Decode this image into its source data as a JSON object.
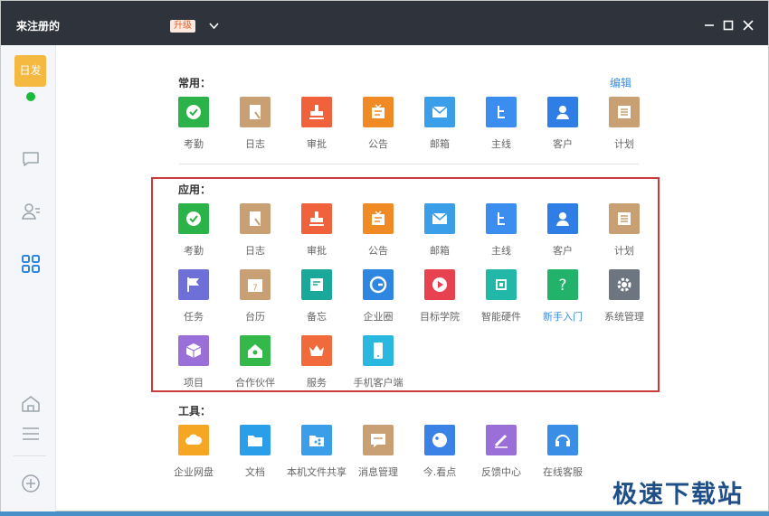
{
  "titlebar": {
    "title": "来注册的",
    "upgrade": "升级"
  },
  "sidebar": {
    "avatar_text": "日发",
    "items": [
      {
        "name": "chat",
        "icon": "chat-bubble-icon"
      },
      {
        "name": "contacts",
        "icon": "contacts-icon"
      },
      {
        "name": "apps",
        "icon": "apps-grid-icon"
      }
    ],
    "bottom": [
      {
        "name": "home",
        "icon": "home-icon"
      },
      {
        "name": "menu",
        "icon": "menu-icon"
      },
      {
        "name": "add",
        "icon": "add-circle-icon"
      }
    ]
  },
  "sections": {
    "common": {
      "label": "常用：",
      "edit": "编辑",
      "items": [
        {
          "label": "考勤",
          "icon": "check-icon",
          "color": "#2bb34a"
        },
        {
          "label": "日志",
          "icon": "log-book-icon",
          "color": "#c9a073"
        },
        {
          "label": "审批",
          "icon": "stamp-icon",
          "color": "#f0623c"
        },
        {
          "label": "公告",
          "icon": "notice-icon",
          "color": "#f08a24"
        },
        {
          "label": "邮箱",
          "icon": "mail-icon",
          "color": "#3a9ee8"
        },
        {
          "label": "主线",
          "icon": "mainline-icon",
          "color": "#3b8ef0"
        },
        {
          "label": "客户",
          "icon": "customer-icon",
          "color": "#2f7ee6"
        },
        {
          "label": "计划",
          "icon": "plan-icon",
          "color": "#c9a073"
        }
      ]
    },
    "apps": {
      "label": "应用：",
      "items": [
        {
          "label": "考勤",
          "icon": "check-icon",
          "color": "#2bb34a"
        },
        {
          "label": "日志",
          "icon": "log-book-icon",
          "color": "#c9a073"
        },
        {
          "label": "审批",
          "icon": "stamp-icon",
          "color": "#f0623c"
        },
        {
          "label": "公告",
          "icon": "notice-icon",
          "color": "#f08a24"
        },
        {
          "label": "邮箱",
          "icon": "mail-icon",
          "color": "#3a9ee8"
        },
        {
          "label": "主线",
          "icon": "mainline-icon",
          "color": "#3b8ef0"
        },
        {
          "label": "客户",
          "icon": "customer-icon",
          "color": "#2f7ee6"
        },
        {
          "label": "计划",
          "icon": "plan-icon",
          "color": "#c9a073"
        },
        {
          "label": "任务",
          "icon": "flag-icon",
          "color": "#6f6fd8"
        },
        {
          "label": "台历",
          "icon": "calendar-icon",
          "color": "#c9a073"
        },
        {
          "label": "备忘",
          "icon": "memo-icon",
          "color": "#1aa89a"
        },
        {
          "label": "企业圈",
          "icon": "circle-g-icon",
          "color": "#2f86e0"
        },
        {
          "label": "目标学院",
          "icon": "play-icon",
          "color": "#e8414f"
        },
        {
          "label": "智能硬件",
          "icon": "chip-icon",
          "color": "#22b8a8"
        },
        {
          "label": "新手入门",
          "icon": "question-icon",
          "color": "#22b26a"
        },
        {
          "label": "系统管理",
          "icon": "gear-icon",
          "color": "#6c7580"
        },
        {
          "label": "项目",
          "icon": "cube-icon",
          "color": "#9a6fd8"
        },
        {
          "label": "合作伙伴",
          "icon": "partner-home-icon",
          "color": "#34b84a"
        },
        {
          "label": "服务",
          "icon": "crown-icon",
          "color": "#f06a3c"
        },
        {
          "label": "手机客户端",
          "icon": "phone-icon",
          "color": "#2ab8e0"
        }
      ]
    },
    "tools": {
      "label": "工具：",
      "items": [
        {
          "label": "企业网盘",
          "icon": "cloud-icon",
          "color": "#f5a623"
        },
        {
          "label": "文档",
          "icon": "folder-icon",
          "color": "#2a9ee8"
        },
        {
          "label": "本机文件共享",
          "icon": "file-share-icon",
          "color": "#3a9ee8"
        },
        {
          "label": "消息管理",
          "icon": "message-icon",
          "color": "#c9a073"
        },
        {
          "label": "今.看点",
          "icon": "bubble-icon",
          "color": "#3b82e6"
        },
        {
          "label": "反馈中心",
          "icon": "pen-icon",
          "color": "#9a6fd8"
        },
        {
          "label": "在线客服",
          "icon": "headset-icon",
          "color": "#3a8ee6"
        }
      ]
    }
  },
  "watermark": "极速下载站"
}
